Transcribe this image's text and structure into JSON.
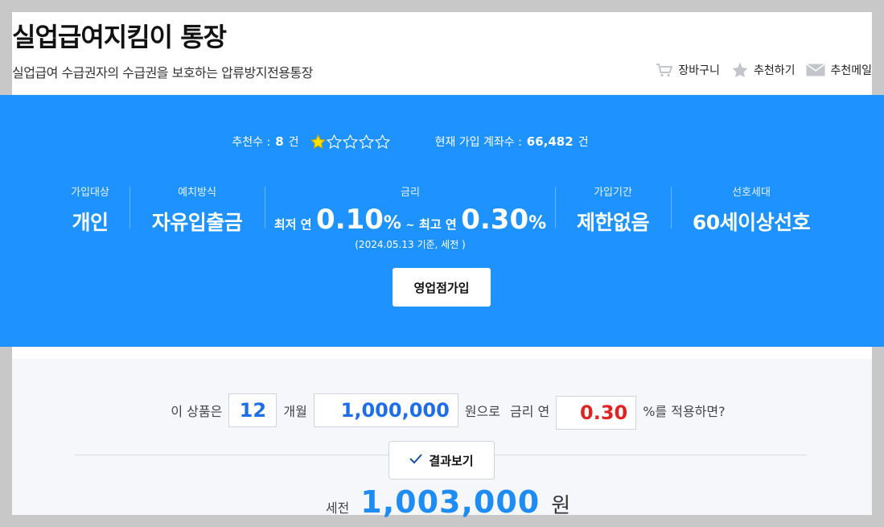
{
  "header": {
    "title": "실업급여지킴이 통장",
    "subtitle": "실업급여 수급권자의 수급권을 보호하는 압류방지전용통장",
    "cart_label": "장바구니",
    "recommend_label": "추천하기",
    "email_label": "추천메일"
  },
  "stats": {
    "recommend_prefix": "추천수 :",
    "recommend_count": "8",
    "recommend_unit": "건",
    "rating": 1,
    "rating_max": 5,
    "accounts_prefix": "현재 가입 계좌수 :",
    "accounts_count": "66,482",
    "accounts_unit": "건"
  },
  "info": {
    "target_label": "가입대상",
    "target_value": "개인",
    "deposit_label": "예치방식",
    "deposit_value": "자유입출금",
    "rate_label": "금리",
    "rate_min_prefix": "최저 연",
    "rate_min_value": "0.10",
    "rate_max_prefix": "최고 연",
    "rate_max_value": "0.30",
    "rate_pct": "%",
    "rate_tilde": "~",
    "rate_note": "(2024.05.13 기준, 세전 )",
    "period_label": "가입기간",
    "period_value": "제한없음",
    "preferred_label": "선호세대",
    "preferred_value": "60세이상선호"
  },
  "join_button": "영업점가입",
  "calculator": {
    "prefix": "이 상품은",
    "months": "12",
    "months_unit": "개월",
    "amount": "1,000,000",
    "amount_unit": "원으로",
    "rate_prefix": "금리 연",
    "rate": "0.30",
    "rate_suffix": "%를 적용하면?",
    "result_button": "결과보기",
    "result_prefix": "세전",
    "result_amount": "1,003,000",
    "result_unit": "원"
  },
  "colors": {
    "banner": "#1e93ff",
    "amount_blue": "#1e6ee8",
    "rate_red": "#e02424",
    "star_filled": "#ffe000"
  }
}
